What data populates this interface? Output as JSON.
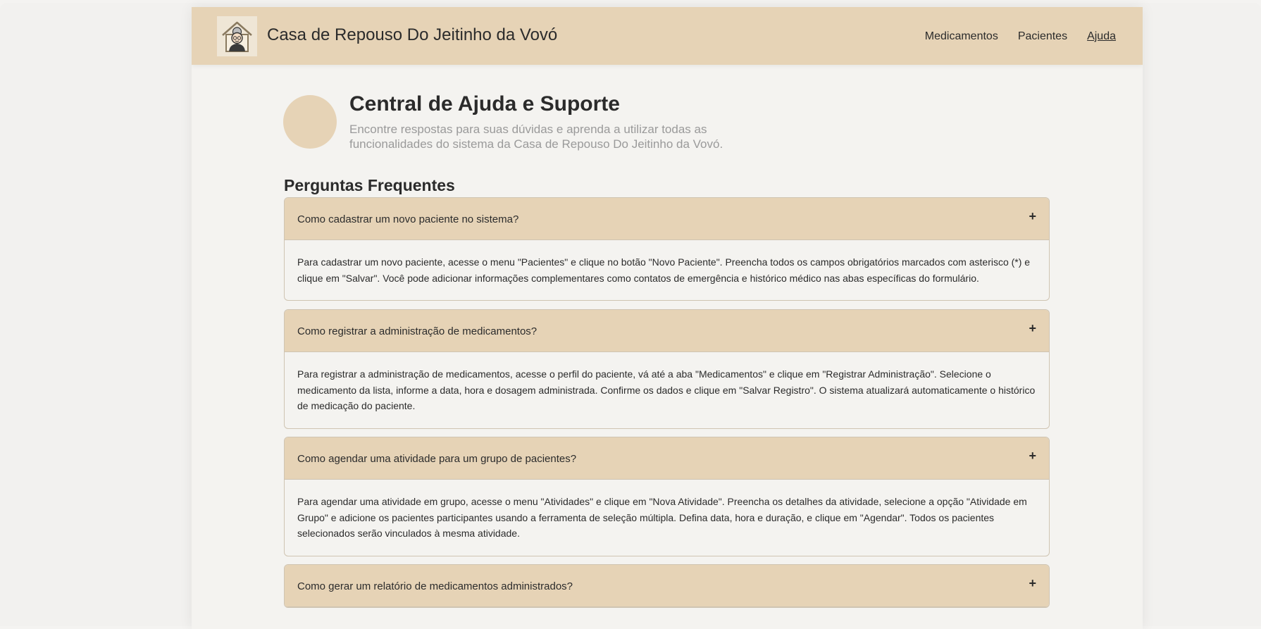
{
  "header": {
    "brand": "Casa de Repouso Do Jeitinho da Vovó",
    "nav": [
      "Medicamentos",
      "Pacientes",
      "Ajuda"
    ],
    "active_nav": "Ajuda",
    "logo_icon": "grandma-house-icon"
  },
  "hero": {
    "title": "Central de Ajuda e Suporte",
    "subtitle": "Encontre respostas para suas dúvidas e aprenda a utilizar todas as funcionalidades do sistema da Casa de Repouso Do Jeitinho da Vovó."
  },
  "faq": {
    "title": "Perguntas Frequentes",
    "expand_icon": "+",
    "items": [
      {
        "question": "Como cadastrar um novo paciente no sistema?",
        "answer": "Para cadastrar um novo paciente, acesse o menu \"Pacientes\" e clique no botão \"Novo Paciente\". Preencha todos os campos obrigatórios marcados com asterisco (*) e clique em \"Salvar\". Você pode adicionar informações complementares como contatos de emergência e histórico médico nas abas específicas do formulário."
      },
      {
        "question": "Como registrar a administração de medicamentos?",
        "answer": "Para registrar a administração de medicamentos, acesse o perfil do paciente, vá até a aba \"Medicamentos\" e clique em \"Registrar Administração\". Selecione o medicamento da lista, informe a data, hora e dosagem administrada. Confirme os dados e clique em \"Salvar Registro\". O sistema atualizará automaticamente o histórico de medicação do paciente."
      },
      {
        "question": "Como agendar uma atividade para um grupo de pacientes?",
        "answer": "Para agendar uma atividade em grupo, acesse o menu \"Atividades\" e clique em \"Nova Atividade\". Preencha os detalhes da atividade, selecione a opção \"Atividade em Grupo\" e adicione os pacientes participantes usando a ferramenta de seleção múltipla. Defina data, hora e duração, e clique em \"Agendar\". Todos os pacientes selecionados serão vinculados à mesma atividade."
      },
      {
        "question": "Como gerar um relatório de medicamentos administrados?",
        "answer": ""
      }
    ]
  },
  "colors": {
    "accent": "#e6d3b6",
    "background": "#f4f3f0",
    "text": "#2b2b2b",
    "muted": "#9a9a9a"
  }
}
